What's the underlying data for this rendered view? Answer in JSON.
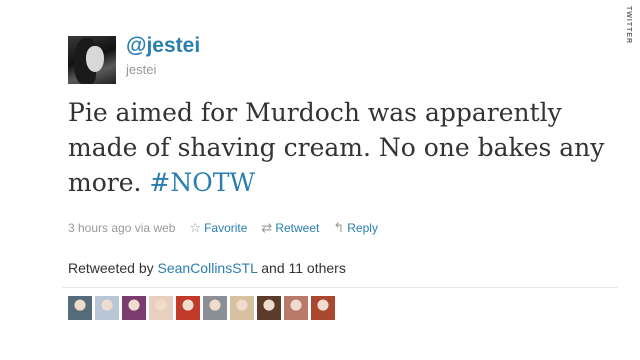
{
  "brand": {
    "side_label": "TWITTER"
  },
  "author": {
    "handle": "@jestei",
    "username": "jestei"
  },
  "tweet": {
    "text": "Pie aimed for Murdoch was apparently made of shaving cream. No one bakes any more.",
    "hashtag": "#NOTW"
  },
  "meta": {
    "time": "3 hours ago via web",
    "favorite_label": "Favorite",
    "retweet_label": "Retweet",
    "reply_label": "Reply"
  },
  "retweets": {
    "prefix": "Retweeted by",
    "user": "SeanCollinsSTL",
    "suffix": "and 11 others"
  },
  "colors": {
    "link": "#2a7fb0",
    "muted": "#999999",
    "text": "#333333"
  },
  "retweeter_avatars": [
    {
      "color": "#556b7a",
      "icon": "avatar-icon"
    },
    {
      "color": "#b8c6d8",
      "icon": "avatar-icon"
    },
    {
      "color": "#7a3b6e",
      "icon": "avatar-icon"
    },
    {
      "color": "#e8cfc0",
      "icon": "avatar-icon"
    },
    {
      "color": "#c23a2a",
      "icon": "avatar-icon"
    },
    {
      "color": "#8a8f96",
      "icon": "avatar-icon"
    },
    {
      "color": "#d7c1a0",
      "icon": "avatar-icon"
    },
    {
      "color": "#5c3b2a",
      "icon": "avatar-icon"
    },
    {
      "color": "#b97a6a",
      "icon": "avatar-icon"
    },
    {
      "color": "#a9482e",
      "icon": "avatar-icon"
    }
  ]
}
